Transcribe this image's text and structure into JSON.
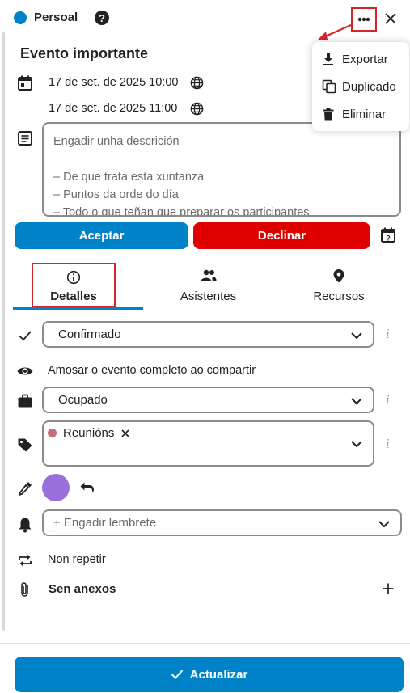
{
  "header": {
    "calendar_name": "Persoal",
    "calendar_color": "#0082c9"
  },
  "event": {
    "title": "Evento importante",
    "start": "17 de set. de 2025 10:00",
    "end": "17 de set. de 2025 11:00",
    "description_placeholder": "Engadir unha descrición",
    "description_lines": [
      "– De que trata esta xuntanza",
      "– Puntos da orde do día",
      "– Todo o que teñan que preparar os participantes"
    ]
  },
  "actions": {
    "accept": "Aceptar",
    "decline": "Declinar"
  },
  "tabs": [
    {
      "label": "Detalles",
      "active": true
    },
    {
      "label": "Asistentes",
      "active": false
    },
    {
      "label": "Recursos",
      "active": false
    }
  ],
  "details": {
    "status": "Confirmado",
    "visibility_text": "Amosar o evento completo ao compartir",
    "availability": "Ocupado",
    "category": "Reunións",
    "category_color": "#c26f7b",
    "event_color": "#9b6fd9",
    "reminder_placeholder": "+ Engadir lembrete",
    "repeat": "Non repetir",
    "attachments": "Sen anexos",
    "info_glyph": "i"
  },
  "menu": {
    "items": [
      {
        "label": "Exportar",
        "icon": "download-icon"
      },
      {
        "label": "Duplicado",
        "icon": "duplicate-icon"
      },
      {
        "label": "Eliminar",
        "icon": "trash-icon"
      }
    ]
  },
  "footer": {
    "update": "Actualizar"
  },
  "colors": {
    "primary": "#0082c9",
    "danger": "#e00000",
    "annotation": "#d9232a"
  }
}
